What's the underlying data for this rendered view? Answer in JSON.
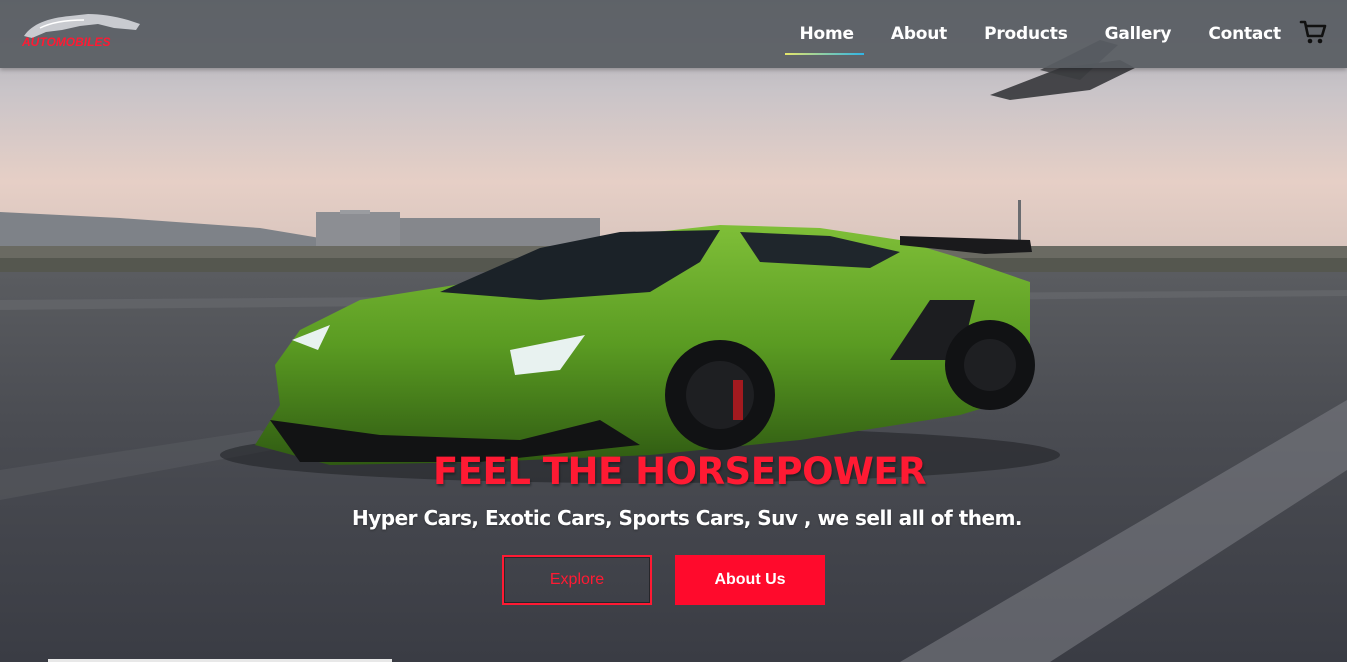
{
  "brand": {
    "logo_icon": "car-silhouette-logo",
    "logo_text": "AUTOMOBILES",
    "accent_color": "#ff1a33"
  },
  "nav": {
    "items": [
      {
        "label": "Home",
        "active": true
      },
      {
        "label": "About",
        "active": false
      },
      {
        "label": "Products",
        "active": false
      },
      {
        "label": "Gallery",
        "active": false
      },
      {
        "label": "Contact",
        "active": false
      }
    ],
    "cart_icon": "shopping-cart-icon"
  },
  "hero": {
    "title": "FEEL THE HORSEPOWER",
    "subtitle": "Hyper Cars, Exotic Cars, Sports Cars, Suv , we sell all of them.",
    "explore_label": "Explore",
    "about_label": "About Us"
  }
}
